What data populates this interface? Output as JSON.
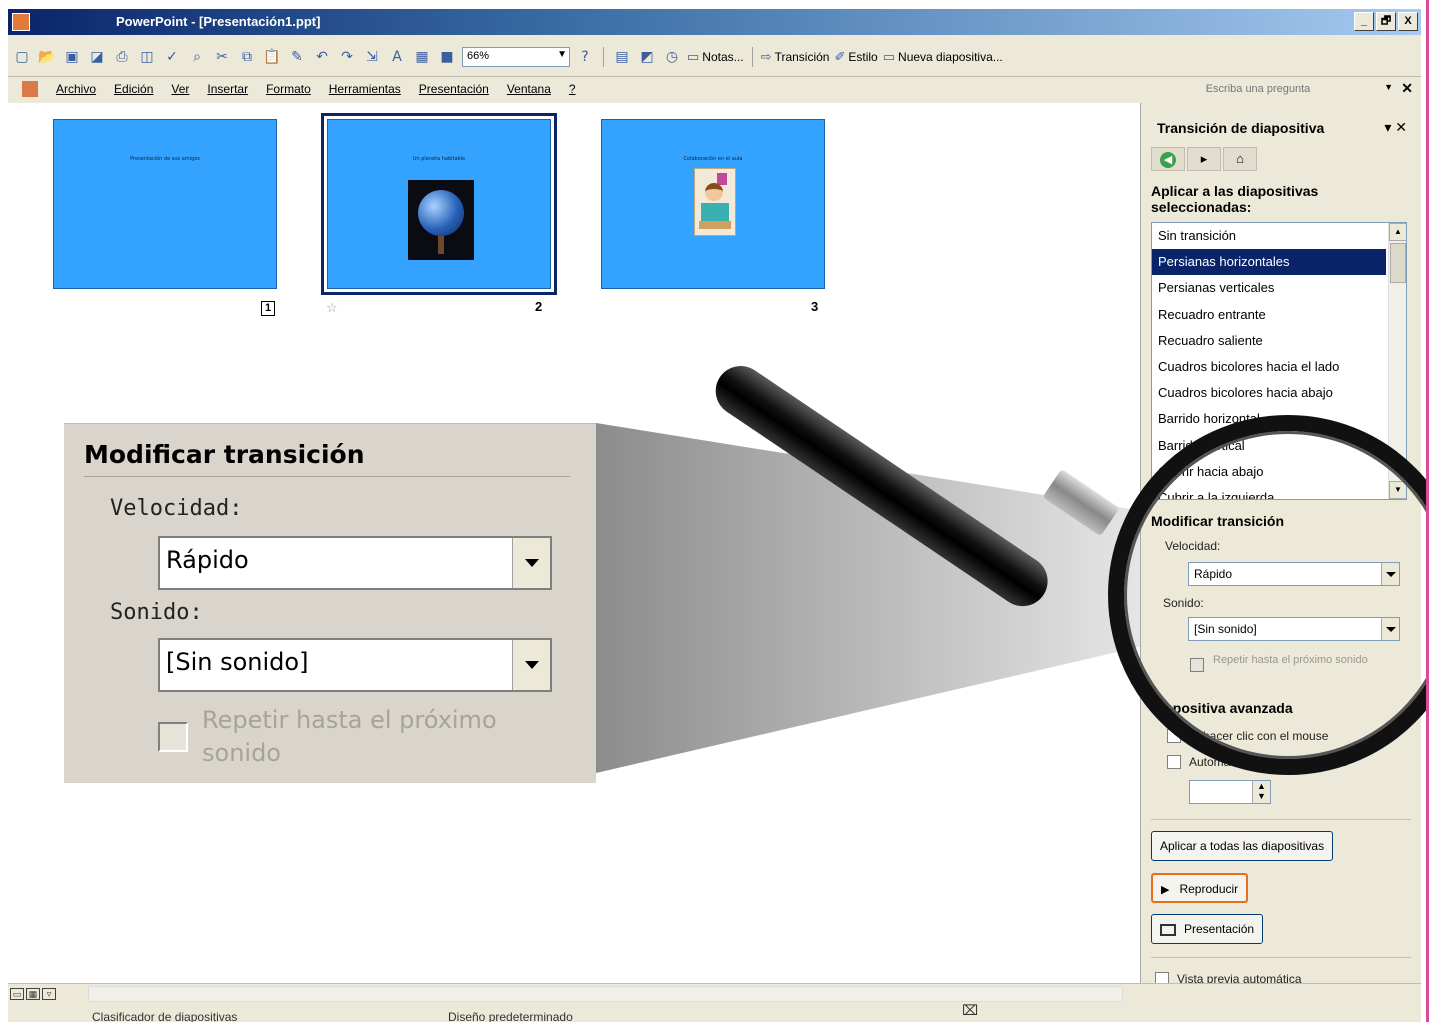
{
  "window": {
    "title": "PowerPoint - [Presentación1.ppt]",
    "buttons": [
      "_",
      "🗗",
      "X"
    ]
  },
  "toolbar": {
    "zoom": "66%",
    "notes_label": "Notas...",
    "transition_label": "Transición",
    "style_label": "Estilo",
    "new_slide_label": "Nueva diapositiva..."
  },
  "menu": {
    "items": [
      "Archivo",
      "Edición",
      "Ver",
      "Insertar",
      "Formato",
      "Herramientas",
      "Presentación",
      "Ventana",
      "?"
    ],
    "ask_placeholder": "Escriba una pregunta"
  },
  "slides": [
    {
      "number": "1",
      "text": "Presentación de sus amigos"
    },
    {
      "number": "2",
      "text": "Un planeta habitable"
    },
    {
      "number": "3",
      "text": "Colaboración en el aula"
    }
  ],
  "zoom_panel": {
    "title": "Modificar transición",
    "speed_label": "Velocidad:",
    "speed_value": "Rápido",
    "sound_label": "Sonido:",
    "sound_value": "[Sin sonido]",
    "repeat_label": "Repetir hasta el próximo sonido"
  },
  "taskpane": {
    "title": "Transición de diapositiva",
    "apply_label": "Aplicar a las diapositivas seleccionadas:",
    "transitions": [
      "Sin transición",
      "Persianas horizontales",
      "Persianas verticales",
      "Recuadro entrante",
      "Recuadro saliente",
      "Cuadros bicolores hacia el lado",
      "Cuadros bicolores hacia abajo",
      "Barrido horizontal",
      "Barrido vertical",
      "Cubrir hacia abajo",
      "Cubrir a la izquierda"
    ],
    "selected_transition": "Persianas horizontales",
    "modify_title": "Modificar transición",
    "speed_label": "Velocidad:",
    "speed_value": "Rápido",
    "sound_label": "Sonido:",
    "sound_value": "[Sin sonido]",
    "repeat_label": "Repetir hasta el próximo sonido",
    "advance_title": "Diapositiva avanzada",
    "on_click_label": "Al hacer clic con el mouse",
    "auto_label": "Automáticamente después de",
    "apply_all_button": "Aplicar a todas las diapositivas",
    "play_button": "Reproducir",
    "slideshow_button": "Presentación",
    "autopreview_label": "Vista previa automática"
  },
  "status": {
    "view": "Clasificador de diapositivas",
    "design": "Diseño predeterminado"
  },
  "colors": {
    "slide_bg": "#33a3ff",
    "selection": "#0a246a",
    "play_highlight": "#e56e1f"
  }
}
